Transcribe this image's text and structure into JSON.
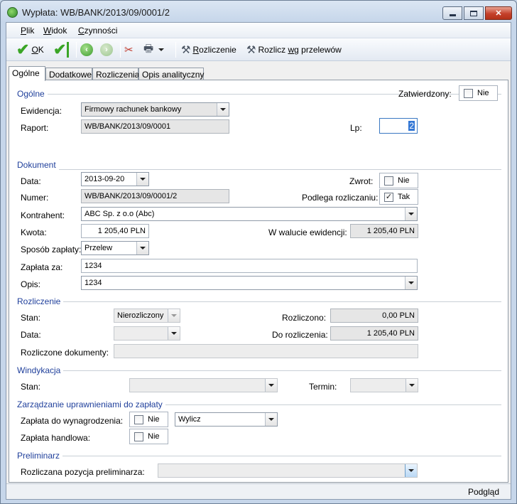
{
  "window": {
    "title": "Wypłata: WB/BANK/2013/09/0001/2",
    "close_symbol": "✕"
  },
  "menu": [
    {
      "u": "P",
      "rest": "lik"
    },
    {
      "u": "W",
      "rest": "idok"
    },
    {
      "u": "C",
      "rest": "zynności"
    }
  ],
  "toolbar": {
    "ok_u": "O",
    "ok_rest": "K",
    "rozliczenie_u": "R",
    "rozliczenie_rest": "ozliczenie",
    "rozlicz_prefix": "Rozlicz ",
    "rozlicz_u": "w",
    "rozlicz_rest": "g przelewów",
    "icons": [
      "ok-check-icon",
      "ok-close-check-icon",
      "back-icon",
      "forward-icon",
      "tools-icon",
      "printer-icon",
      "settle-icon"
    ]
  },
  "tabs": [
    "Ogólne",
    "Dodatkowe",
    "Rozliczenia",
    "Opis analityczny"
  ],
  "sections": {
    "ogolne": "Ogólne",
    "dokument": "Dokument",
    "rozliczenie": "Rozliczenie",
    "windykacja": "Windykacja",
    "zarzadzanie": "Zarządzanie uprawnieniami do zapłaty",
    "preliminarz": "Preliminarz"
  },
  "ogolne": {
    "zatwierdzony_label": "Zatwierdzony:",
    "zatwierdzony_value": "Nie",
    "ewidencja_label": "Ewidencja:",
    "ewidencja_value": "Firmowy rachunek bankowy",
    "raport_label": "Raport:",
    "raport_value": "WB/BANK/2013/09/0001",
    "lp_label": "Lp:",
    "lp_value": "2"
  },
  "dokument": {
    "data_label": "Data:",
    "data_value": "2013-09-20",
    "zwrot_label": "Zwrot:",
    "zwrot_value": "Nie",
    "numer_label": "Numer:",
    "numer_value": "WB/BANK/2013/09/0001/2",
    "podlega_label": "Podlega rozliczaniu:",
    "podlega_value": "Tak",
    "podlega_mark": "✓",
    "kontrahent_label": "Kontrahent:",
    "kontrahent_value": "ABC Sp. z o.o (Abc)",
    "kwota_label": "Kwota:",
    "kwota_value": "1 205,40 PLN",
    "waluta_label": "W walucie ewidencji:",
    "waluta_value": "1 205,40 PLN",
    "sposob_label": "Sposób zapłaty:",
    "sposob_value": "Przelew",
    "zaplata_label": "Zapłata za:",
    "zaplata_value": "1234",
    "opis_label": "Opis:",
    "opis_value": "1234"
  },
  "rozliczenie": {
    "stan_label": "Stan:",
    "stan_value": "Nierozliczony",
    "rozliczono_label": "Rozliczono:",
    "rozliczono_value": "0,00 PLN",
    "data_label": "Data:",
    "do_label": "Do rozliczenia:",
    "do_value": "1 205,40 PLN",
    "dokumenty_label": "Rozliczone dokumenty:"
  },
  "windykacja": {
    "stan_label": "Stan:",
    "termin_label": "Termin:"
  },
  "zarzadzanie": {
    "wynagrodzenie_label": "Zapłata do wynagrodzenia:",
    "wynagrodzenie_value": "Nie",
    "wylicz_value": "Wylicz",
    "handlowa_label": "Zapłata handlowa:",
    "handlowa_value": "Nie"
  },
  "preliminarz": {
    "pozycja_label": "Rozliczana pozycja preliminarza:"
  },
  "status": {
    "podglad": "Podgląd"
  }
}
